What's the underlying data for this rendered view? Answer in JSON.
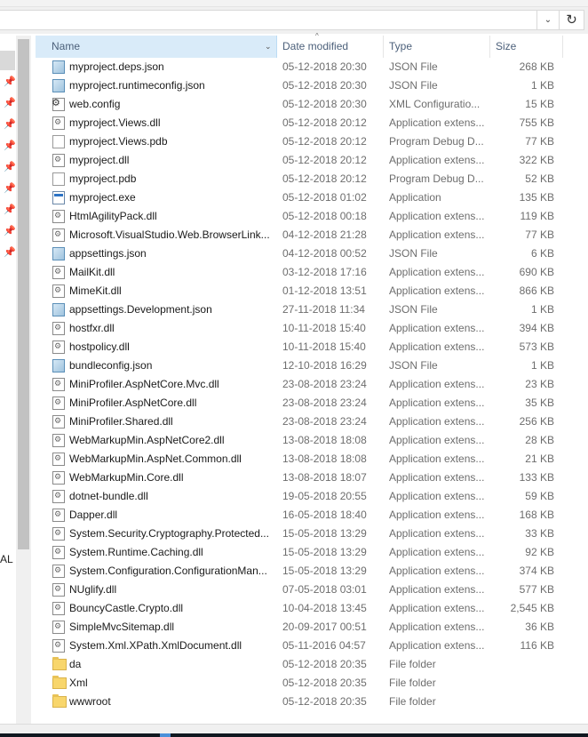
{
  "address": {
    "path": "",
    "refresh_glyph": "↻",
    "dropdown_glyph": "⌄"
  },
  "nav": {
    "partial_label": "AL",
    "pin_glyph": "📌"
  },
  "columns": {
    "name": "Name",
    "date": "Date modified",
    "type": "Type",
    "size": "Size",
    "sort_glyph": "^",
    "chevron_glyph": "⌄"
  },
  "files": [
    {
      "name": "myproject.deps.json",
      "date": "05-12-2018 20:30",
      "type": "JSON File",
      "size": "268 KB",
      "icon": "json"
    },
    {
      "name": "myproject.runtimeconfig.json",
      "date": "05-12-2018 20:30",
      "type": "JSON File",
      "size": "1 KB",
      "icon": "json"
    },
    {
      "name": "web.config",
      "date": "05-12-2018 20:30",
      "type": "XML Configuratio...",
      "size": "15 KB",
      "icon": "config"
    },
    {
      "name": "myproject.Views.dll",
      "date": "05-12-2018 20:12",
      "type": "Application extens...",
      "size": "755 KB",
      "icon": "dll"
    },
    {
      "name": "myproject.Views.pdb",
      "date": "05-12-2018 20:12",
      "type": "Program Debug D...",
      "size": "77 KB",
      "icon": "pdb"
    },
    {
      "name": "myproject.dll",
      "date": "05-12-2018 20:12",
      "type": "Application extens...",
      "size": "322 KB",
      "icon": "dll"
    },
    {
      "name": "myproject.pdb",
      "date": "05-12-2018 20:12",
      "type": "Program Debug D...",
      "size": "52 KB",
      "icon": "pdb"
    },
    {
      "name": "myproject.exe",
      "date": "05-12-2018 01:02",
      "type": "Application",
      "size": "135 KB",
      "icon": "exe"
    },
    {
      "name": "HtmlAgilityPack.dll",
      "date": "05-12-2018 00:18",
      "type": "Application extens...",
      "size": "119 KB",
      "icon": "dll"
    },
    {
      "name": "Microsoft.VisualStudio.Web.BrowserLink....",
      "date": "04-12-2018 21:28",
      "type": "Application extens...",
      "size": "77 KB",
      "icon": "dll"
    },
    {
      "name": "appsettings.json",
      "date": "04-12-2018 00:52",
      "type": "JSON File",
      "size": "6 KB",
      "icon": "json"
    },
    {
      "name": "MailKit.dll",
      "date": "03-12-2018 17:16",
      "type": "Application extens...",
      "size": "690 KB",
      "icon": "dll"
    },
    {
      "name": "MimeKit.dll",
      "date": "01-12-2018 13:51",
      "type": "Application extens...",
      "size": "866 KB",
      "icon": "dll"
    },
    {
      "name": "appsettings.Development.json",
      "date": "27-11-2018 11:34",
      "type": "JSON File",
      "size": "1 KB",
      "icon": "json"
    },
    {
      "name": "hostfxr.dll",
      "date": "10-11-2018 15:40",
      "type": "Application extens...",
      "size": "394 KB",
      "icon": "dll"
    },
    {
      "name": "hostpolicy.dll",
      "date": "10-11-2018 15:40",
      "type": "Application extens...",
      "size": "573 KB",
      "icon": "dll"
    },
    {
      "name": "bundleconfig.json",
      "date": "12-10-2018 16:29",
      "type": "JSON File",
      "size": "1 KB",
      "icon": "json"
    },
    {
      "name": "MiniProfiler.AspNetCore.Mvc.dll",
      "date": "23-08-2018 23:24",
      "type": "Application extens...",
      "size": "23 KB",
      "icon": "dll"
    },
    {
      "name": "MiniProfiler.AspNetCore.dll",
      "date": "23-08-2018 23:24",
      "type": "Application extens...",
      "size": "35 KB",
      "icon": "dll"
    },
    {
      "name": "MiniProfiler.Shared.dll",
      "date": "23-08-2018 23:24",
      "type": "Application extens...",
      "size": "256 KB",
      "icon": "dll"
    },
    {
      "name": "WebMarkupMin.AspNetCore2.dll",
      "date": "13-08-2018 18:08",
      "type": "Application extens...",
      "size": "28 KB",
      "icon": "dll"
    },
    {
      "name": "WebMarkupMin.AspNet.Common.dll",
      "date": "13-08-2018 18:08",
      "type": "Application extens...",
      "size": "21 KB",
      "icon": "dll"
    },
    {
      "name": "WebMarkupMin.Core.dll",
      "date": "13-08-2018 18:07",
      "type": "Application extens...",
      "size": "133 KB",
      "icon": "dll"
    },
    {
      "name": "dotnet-bundle.dll",
      "date": "19-05-2018 20:55",
      "type": "Application extens...",
      "size": "59 KB",
      "icon": "dll"
    },
    {
      "name": "Dapper.dll",
      "date": "16-05-2018 18:40",
      "type": "Application extens...",
      "size": "168 KB",
      "icon": "dll"
    },
    {
      "name": "System.Security.Cryptography.Protected....",
      "date": "15-05-2018 13:29",
      "type": "Application extens...",
      "size": "33 KB",
      "icon": "dll"
    },
    {
      "name": "System.Runtime.Caching.dll",
      "date": "15-05-2018 13:29",
      "type": "Application extens...",
      "size": "92 KB",
      "icon": "dll"
    },
    {
      "name": "System.Configuration.ConfigurationMan...",
      "date": "15-05-2018 13:29",
      "type": "Application extens...",
      "size": "374 KB",
      "icon": "dll"
    },
    {
      "name": "NUglify.dll",
      "date": "07-05-2018 03:01",
      "type": "Application extens...",
      "size": "577 KB",
      "icon": "dll"
    },
    {
      "name": "BouncyCastle.Crypto.dll",
      "date": "10-04-2018 13:45",
      "type": "Application extens...",
      "size": "2,545 KB",
      "icon": "dll"
    },
    {
      "name": "SimpleMvcSitemap.dll",
      "date": "20-09-2017 00:51",
      "type": "Application extens...",
      "size": "36 KB",
      "icon": "dll"
    },
    {
      "name": "System.Xml.XPath.XmlDocument.dll",
      "date": "05-11-2016 04:57",
      "type": "Application extens...",
      "size": "116 KB",
      "icon": "dll"
    },
    {
      "name": "da",
      "date": "05-12-2018 20:35",
      "type": "File folder",
      "size": "",
      "icon": "folder"
    },
    {
      "name": "Xml",
      "date": "05-12-2018 20:35",
      "type": "File folder",
      "size": "",
      "icon": "folder"
    },
    {
      "name": "wwwroot",
      "date": "05-12-2018 20:35",
      "type": "File folder",
      "size": "",
      "icon": "folder"
    }
  ]
}
